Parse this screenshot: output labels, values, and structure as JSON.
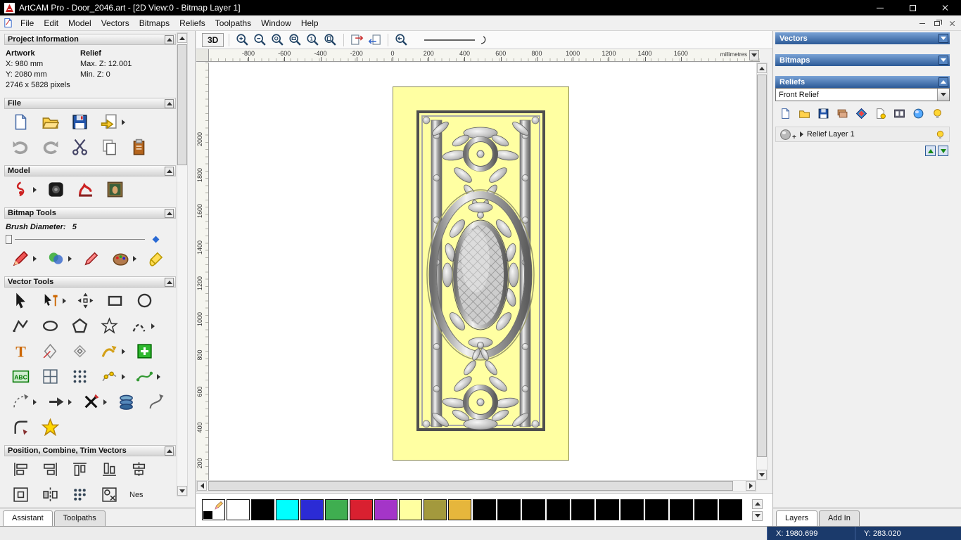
{
  "titlebar": {
    "title": "ArtCAM Pro - Door_2046.art - [2D View:0 - Bitmap Layer 1]"
  },
  "menubar": {
    "items": [
      "File",
      "Edit",
      "Model",
      "Vectors",
      "Bitmaps",
      "Reliefs",
      "Toolpaths",
      "Window",
      "Help"
    ]
  },
  "left_panel": {
    "project_information": {
      "title": "Project Information",
      "artwork_header": "Artwork",
      "relief_header": "Relief",
      "artwork_x": "X: 980 mm",
      "artwork_y": "Y: 2080 mm",
      "relief_max_z": "Max. Z: 12.001",
      "relief_min_z": "Min. Z: 0",
      "pixels": "2746 x 5828 pixels"
    },
    "file": {
      "title": "File",
      "icons_row1": [
        {
          "n": "new-model-icon"
        },
        {
          "n": "open-model-icon"
        },
        {
          "n": "save-model-icon"
        },
        {
          "n": "import-model-icon",
          "f": 1
        }
      ],
      "icons_row2": [
        {
          "n": "undo-icon"
        },
        {
          "n": "redo-icon"
        },
        {
          "n": "cut-icon"
        },
        {
          "n": "paste-icon"
        },
        {
          "n": "notes-icon"
        }
      ]
    },
    "model": {
      "title": "Model",
      "icons": [
        {
          "n": "front-relief-icon",
          "f": 1
        },
        {
          "n": "greyscale-preview-icon"
        },
        {
          "n": "relief-clipart-icon"
        },
        {
          "n": "load-image-icon"
        }
      ]
    },
    "bitmap_tools": {
      "title": "Bitmap Tools",
      "brush_label": "Brush Diameter:",
      "brush_value": "5",
      "icons": [
        {
          "n": "paint-icon",
          "f": 1
        },
        {
          "n": "paint-selective-icon",
          "f": 1
        },
        {
          "n": "draw-icon"
        },
        {
          "n": "colour-palette-icon",
          "f": 1
        },
        {
          "n": "flood-fill-icon"
        }
      ]
    },
    "vector_tools": {
      "title": "Vector Tools",
      "rows": [
        [
          {
            "n": "select-vectors-icon"
          },
          {
            "n": "node-editing-icon",
            "f": 1
          },
          {
            "n": "transform-vectors-icon"
          },
          {
            "n": "create-rectangle-icon"
          },
          {
            "n": "create-circle-icon"
          }
        ],
        [
          {
            "n": "create-polyline-icon"
          },
          {
            "n": "create-ellipse-icon"
          },
          {
            "n": "create-polygon-icon"
          },
          {
            "n": "create-star-icon"
          },
          {
            "n": "create-arc-icon",
            "f": 1
          }
        ],
        [
          {
            "n": "create-text-icon"
          },
          {
            "n": "measure-icon"
          },
          {
            "n": "offset-vector-icon"
          },
          {
            "n": "snip-vector-icon",
            "f": 1
          },
          {
            "n": "block-paste-icon"
          }
        ],
        [
          {
            "n": "text-block-icon"
          },
          {
            "n": "grid-frame-icon"
          },
          {
            "n": "block-array-copy-icon"
          },
          {
            "n": "paste-along-curve-icon",
            "f": 1
          },
          {
            "n": "fit-curve-icon",
            "f": 1
          }
        ],
        [
          {
            "n": "arc-fit-icon",
            "f": 1
          },
          {
            "n": "join-vectors-icon",
            "f": 1
          },
          {
            "n": "trim-vectors-icon",
            "f": 1
          },
          {
            "n": "extrude-icon"
          },
          {
            "n": "vector-doctor-icon"
          }
        ],
        [
          {
            "n": "fillet-icon"
          },
          {
            "n": "wrap-star-icon"
          }
        ]
      ]
    },
    "position": {
      "title": "Position, Combine, Trim Vectors",
      "rows": [
        [
          {
            "n": "align-left-icon"
          },
          {
            "n": "align-right-icon"
          },
          {
            "n": "align-top-icon"
          },
          {
            "n": "align-bottom-icon"
          },
          {
            "n": "align-centre-icon"
          }
        ],
        [
          {
            "n": "centre-in-page-icon"
          },
          {
            "n": "mirror-vectors-icon"
          },
          {
            "n": "block-array-icon"
          },
          {
            "n": "nest-vectors-icon"
          }
        ]
      ],
      "nest_label": "Nes"
    },
    "tabs": [
      {
        "label": "Assistant",
        "active": true
      },
      {
        "label": "Toolpaths",
        "active": false
      }
    ]
  },
  "canvas_toolbar": {
    "view_3d_label": "3D",
    "zoom_icons": [
      {
        "n": "zoom-in-icon"
      },
      {
        "n": "zoom-out-icon"
      },
      {
        "n": "zoom-object-icon"
      },
      {
        "n": "zoom-box-icon"
      },
      {
        "n": "zoom-1to1-icon"
      },
      {
        "n": "zoom-page-icon"
      }
    ],
    "toggle_icons": [
      {
        "n": "toggle-bitmap-icon"
      },
      {
        "n": "toggle-vector-icon"
      }
    ],
    "history_icons": [
      {
        "n": "zoom-previous-icon"
      }
    ]
  },
  "rulers": {
    "horizontal": [
      -800,
      -600,
      -400,
      -200,
      0,
      200,
      400,
      600,
      800,
      1000,
      1200,
      1400,
      1600
    ],
    "vertical": [
      2000,
      1800,
      1600,
      1400,
      1200,
      1000,
      800,
      600,
      400,
      200
    ],
    "units": "millimetres"
  },
  "palette": {
    "colors": [
      "#ffffff",
      "#000000",
      "#00ffff",
      "#2b2bd5",
      "#3fae50",
      "#d92030",
      "#a435c8",
      "#ffffa0",
      "#a3993d",
      "#e6b63c",
      "#000000",
      "#000000",
      "#000000",
      "#000000",
      "#000000",
      "#000000",
      "#000000",
      "#000000",
      "#000000",
      "#000000",
      "#000000"
    ]
  },
  "right_panel": {
    "vectors": {
      "title": "Vectors"
    },
    "bitmaps": {
      "title": "Bitmaps"
    },
    "reliefs": {
      "title": "Reliefs",
      "selected": "Front Relief",
      "icons": [
        {
          "n": "new-relief-icon"
        },
        {
          "n": "open-relief-icon"
        },
        {
          "n": "save-relief-icon"
        },
        {
          "n": "calculate-relief-icon"
        },
        {
          "n": "shape-editor-icon"
        },
        {
          "n": "new-layer-icon"
        },
        {
          "n": "film-strip-icon"
        },
        {
          "n": "sphere-icon"
        },
        {
          "n": "bulb-icon"
        }
      ],
      "layer": {
        "name": "Relief Layer 1"
      }
    },
    "tabs": [
      {
        "label": "Layers",
        "active": true
      },
      {
        "label": "Add In",
        "active": false
      }
    ]
  },
  "statusbar": {
    "x": "X: 1980.699",
    "y": "Y: 283.020"
  }
}
